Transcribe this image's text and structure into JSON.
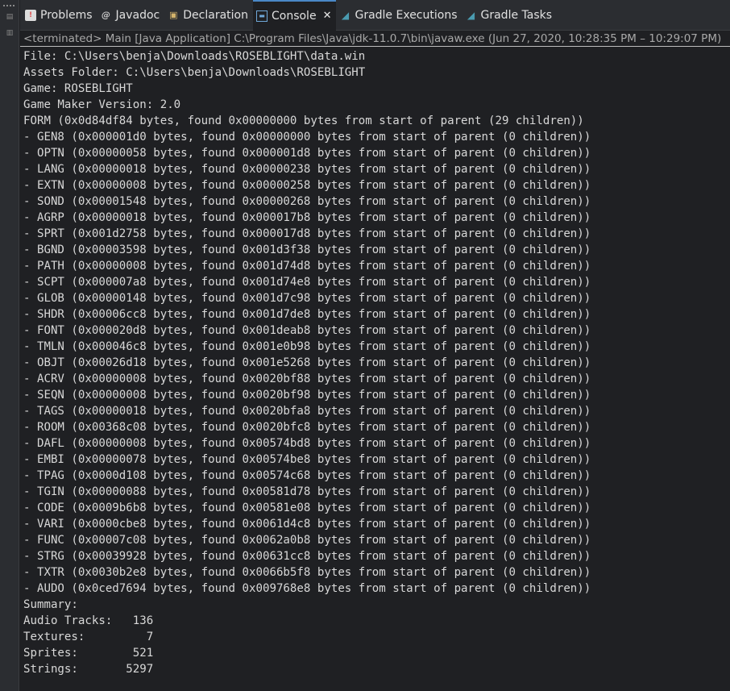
{
  "tabs": [
    {
      "label": "Problems",
      "icon": "problems-icon",
      "active": false
    },
    {
      "label": "Javadoc",
      "icon": "javadoc-icon",
      "active": false
    },
    {
      "label": "Declaration",
      "icon": "declaration-icon",
      "active": false
    },
    {
      "label": "Console",
      "icon": "console-icon",
      "active": true,
      "close": "✕"
    },
    {
      "label": "Gradle Executions",
      "icon": "gradle-executions-icon",
      "active": false
    },
    {
      "label": "Gradle Tasks",
      "icon": "gradle-tasks-icon",
      "active": false
    }
  ],
  "status": "<terminated> Main [Java Application] C:\\Program Files\\Java\\jdk-11.0.7\\bin\\javaw.exe  (Jun 27, 2020, 10:28:35 PM – 10:29:07 PM)",
  "console_lines": [
    "File: C:\\Users\\benja\\Downloads\\ROSEBLIGHT\\data.win",
    "Assets Folder: C:\\Users\\benja\\Downloads\\ROSEBLIGHT",
    "Game: ROSEBLIGHT",
    "Game Maker Version: 2.0",
    "FORM (0x0d84df84 bytes, found 0x00000000 bytes from start of parent (29 children))",
    "- GEN8 (0x000001d0 bytes, found 0x00000000 bytes from start of parent (0 children))",
    "- OPTN (0x00000058 bytes, found 0x000001d8 bytes from start of parent (0 children))",
    "- LANG (0x00000018 bytes, found 0x00000238 bytes from start of parent (0 children))",
    "- EXTN (0x00000008 bytes, found 0x00000258 bytes from start of parent (0 children))",
    "- SOND (0x00001548 bytes, found 0x00000268 bytes from start of parent (0 children))",
    "- AGRP (0x00000018 bytes, found 0x000017b8 bytes from start of parent (0 children))",
    "- SPRT (0x001d2758 bytes, found 0x000017d8 bytes from start of parent (0 children))",
    "- BGND (0x00003598 bytes, found 0x001d3f38 bytes from start of parent (0 children))",
    "- PATH (0x00000008 bytes, found 0x001d74d8 bytes from start of parent (0 children))",
    "- SCPT (0x000007a8 bytes, found 0x001d74e8 bytes from start of parent (0 children))",
    "- GLOB (0x00000148 bytes, found 0x001d7c98 bytes from start of parent (0 children))",
    "- SHDR (0x00006cc8 bytes, found 0x001d7de8 bytes from start of parent (0 children))",
    "- FONT (0x000020d8 bytes, found 0x001deab8 bytes from start of parent (0 children))",
    "- TMLN (0x000046c8 bytes, found 0x001e0b98 bytes from start of parent (0 children))",
    "- OBJT (0x00026d18 bytes, found 0x001e5268 bytes from start of parent (0 children))",
    "- ACRV (0x00000008 bytes, found 0x0020bf88 bytes from start of parent (0 children))",
    "- SEQN (0x00000008 bytes, found 0x0020bf98 bytes from start of parent (0 children))",
    "- TAGS (0x00000018 bytes, found 0x0020bfa8 bytes from start of parent (0 children))",
    "- ROOM (0x00368c08 bytes, found 0x0020bfc8 bytes from start of parent (0 children))",
    "- DAFL (0x00000008 bytes, found 0x00574bd8 bytes from start of parent (0 children))",
    "- EMBI (0x00000078 bytes, found 0x00574be8 bytes from start of parent (0 children))",
    "- TPAG (0x0000d108 bytes, found 0x00574c68 bytes from start of parent (0 children))",
    "- TGIN (0x00000088 bytes, found 0x00581d78 bytes from start of parent (0 children))",
    "- CODE (0x0009b6b8 bytes, found 0x00581e08 bytes from start of parent (0 children))",
    "- VARI (0x0000cbe8 bytes, found 0x0061d4c8 bytes from start of parent (0 children))",
    "- FUNC (0x00007c08 bytes, found 0x0062a0b8 bytes from start of parent (0 children))",
    "- STRG (0x00039928 bytes, found 0x00631cc8 bytes from start of parent (0 children))",
    "- TXTR (0x0030b2e8 bytes, found 0x0066b5f8 bytes from start of parent (0 children))",
    "- AUDO (0x0ced7694 bytes, found 0x009768e8 bytes from start of parent (0 children))",
    "Summary:",
    "Audio Tracks:   136",
    "Textures:         7",
    "Sprites:        521",
    "Strings:       5297"
  ]
}
